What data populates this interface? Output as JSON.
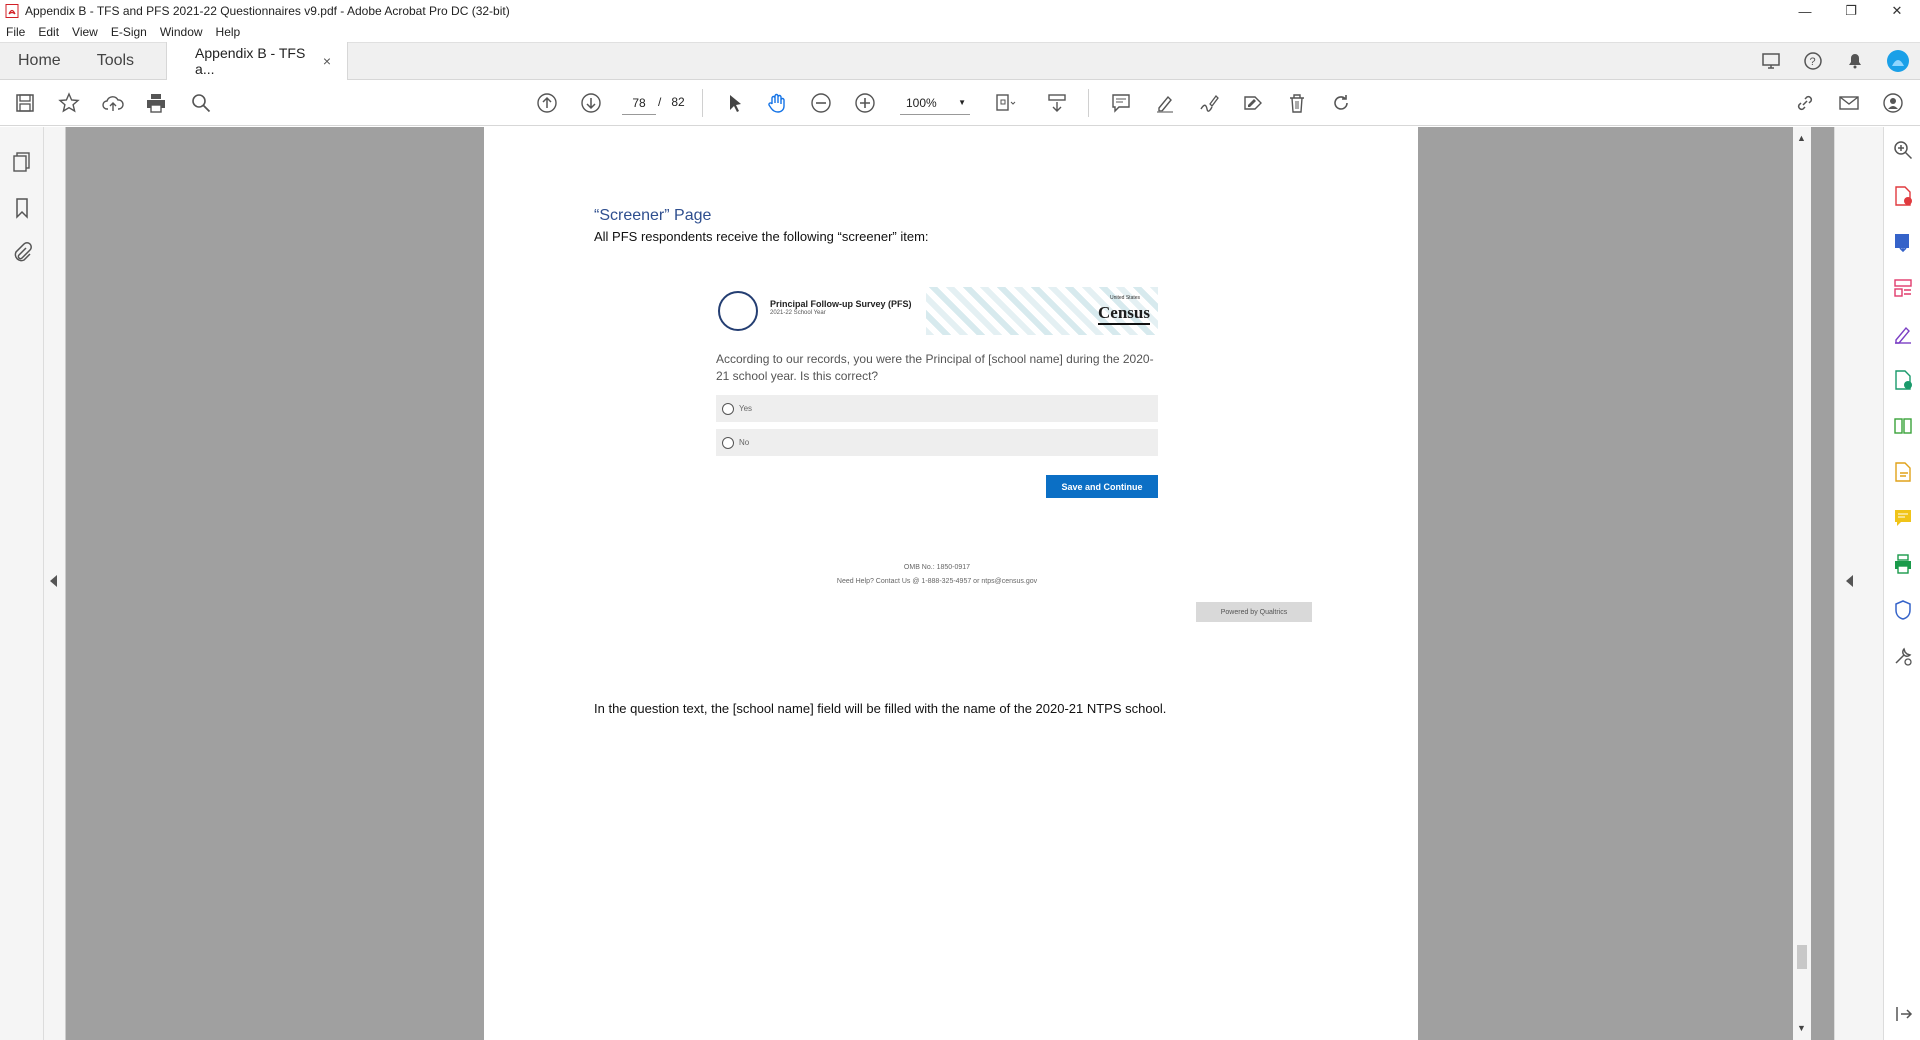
{
  "window": {
    "title": "Appendix B - TFS and PFS 2021-22 Questionnaires v9.pdf - Adobe Acrobat Pro DC (32-bit)"
  },
  "menu": [
    "File",
    "Edit",
    "View",
    "E-Sign",
    "Window",
    "Help"
  ],
  "tabs": {
    "home": "Home",
    "tools": "Tools",
    "document": "Appendix B - TFS a...",
    "close": "×"
  },
  "toolbar": {
    "page_current": "78",
    "page_separator": "/",
    "page_total": "82",
    "zoom": "100%"
  },
  "document": {
    "heading": "“Screener” Page",
    "intro": "All PFS respondents receive the following “screener” item:",
    "footer_note": "In the question text, the [school name] field will be filled with the name of the 2020-21 NTPS school."
  },
  "survey": {
    "title": "Principal Follow-up Survey (PFS)",
    "subtitle": "2021-22 School Year",
    "census_top": "United States",
    "census_logo": "Census",
    "question": "According to our records, you were the Principal of  [school name]  during the 2020-21 school year. Is this correct?",
    "options": [
      "Yes",
      "No"
    ],
    "button": "Save and Continue",
    "omb": "OMB No.: 1850-0917",
    "help": "Need Help? Contact Us @ 1-888-325-4957 or ntps@census.gov",
    "powered": "Powered by Qualtrics"
  },
  "colors": {
    "accent": "#0b6fc5",
    "heading": "#2f4f8f",
    "viewer_bg": "#a0a0a0"
  }
}
